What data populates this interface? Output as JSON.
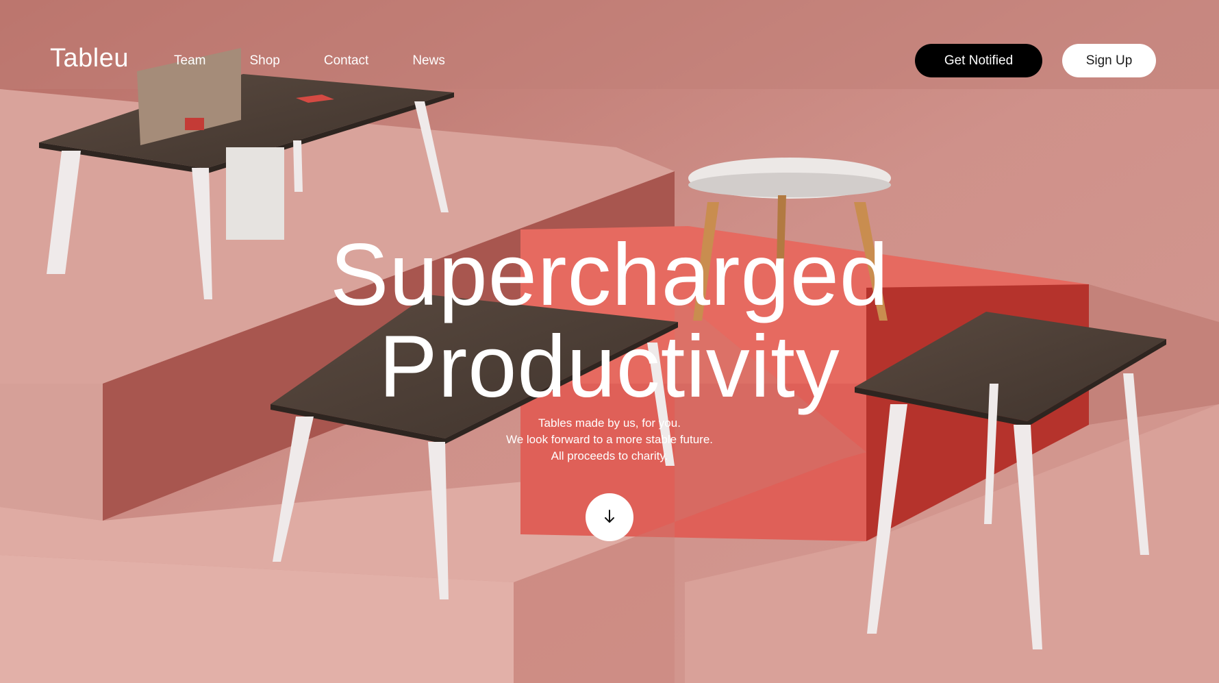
{
  "brand": {
    "logo": "Tableu"
  },
  "nav": {
    "links": [
      {
        "label": "Team"
      },
      {
        "label": "Shop"
      },
      {
        "label": "Contact"
      },
      {
        "label": "News"
      }
    ]
  },
  "actions": {
    "get_notified": "Get Notified",
    "sign_up": "Sign Up"
  },
  "hero": {
    "title_line1": "Supercharged",
    "title_line2": "Productivity",
    "subtitle_lines": [
      "Tables made by us, for you.",
      "We look forward to a more stable future.",
      "All proceeds to charity."
    ],
    "scroll_icon": "arrow-down-icon"
  },
  "colors": {
    "background": "#c98a83",
    "accent_red": "#d9544c",
    "button_dark": "#000000",
    "button_light": "#ffffff",
    "text": "#ffffff"
  }
}
